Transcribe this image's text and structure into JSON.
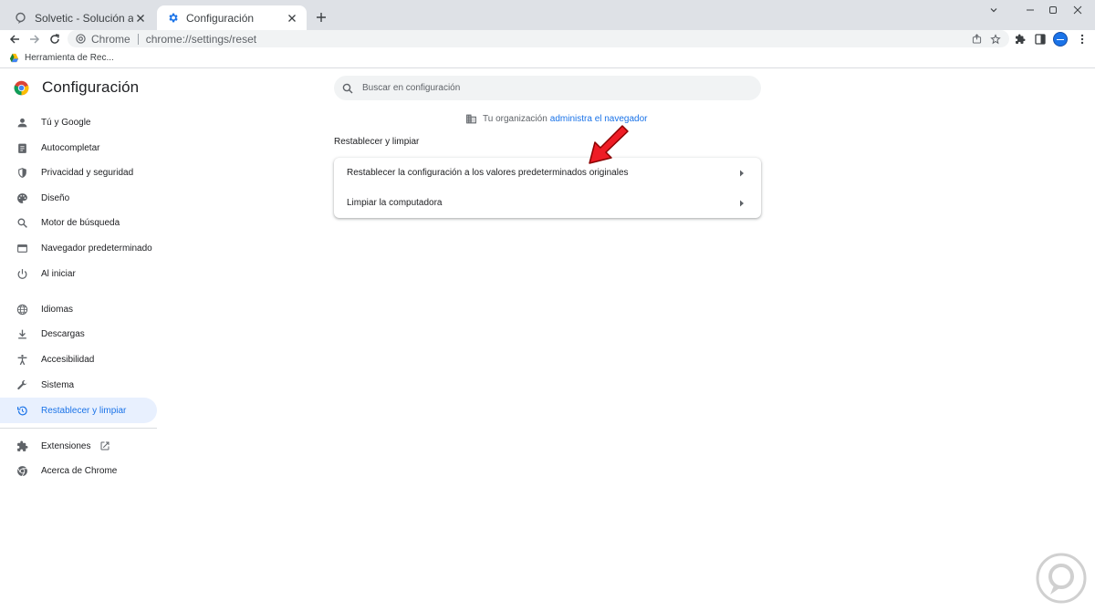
{
  "tabs": [
    {
      "title": "Solvetic - Solución a los problem",
      "icon": "solvetic-icon"
    },
    {
      "title": "Configuración",
      "icon": "gear-icon"
    }
  ],
  "omnibox": {
    "site_label": "Chrome",
    "url_scheme": "chrome://",
    "url_path": "settings/reset"
  },
  "bookmarks": [
    {
      "label": "Herramienta de Rec..."
    }
  ],
  "settings": {
    "title": "Configuración",
    "search_placeholder": "Buscar en configuración",
    "managed_prefix": "Tu organización",
    "managed_link": "administra el navegador",
    "section_title": "Restablecer y limpiar",
    "rows": [
      {
        "label": "Restablecer la configuración a los valores predeterminados originales"
      },
      {
        "label": "Limpiar la computadora"
      }
    ]
  },
  "sidebar": {
    "items": [
      {
        "label": "Tú y Google",
        "icon": "person-icon"
      },
      {
        "label": "Autocompletar",
        "icon": "clipboard-icon"
      },
      {
        "label": "Privacidad y seguridad",
        "icon": "shield-icon"
      },
      {
        "label": "Diseño",
        "icon": "palette-icon"
      },
      {
        "label": "Motor de búsqueda",
        "icon": "search-icon"
      },
      {
        "label": "Navegador predeterminado",
        "icon": "browser-icon"
      },
      {
        "label": "Al iniciar",
        "icon": "power-icon"
      },
      {
        "label": "Idiomas",
        "icon": "globe-icon"
      },
      {
        "label": "Descargas",
        "icon": "download-icon"
      },
      {
        "label": "Accesibilidad",
        "icon": "accessibility-icon"
      },
      {
        "label": "Sistema",
        "icon": "wrench-icon"
      },
      {
        "label": "Restablecer y limpiar",
        "icon": "reset-icon",
        "active": true
      },
      {
        "label": "Extensiones",
        "icon": "puzzle-icon"
      },
      {
        "label": "Acerca de Chrome",
        "icon": "chrome-icon"
      }
    ]
  },
  "colors": {
    "accent": "#1a73e8",
    "active_bg": "#e8f0fe",
    "tabstrip": "#dee1e6",
    "pointer": "#ee1c25"
  }
}
